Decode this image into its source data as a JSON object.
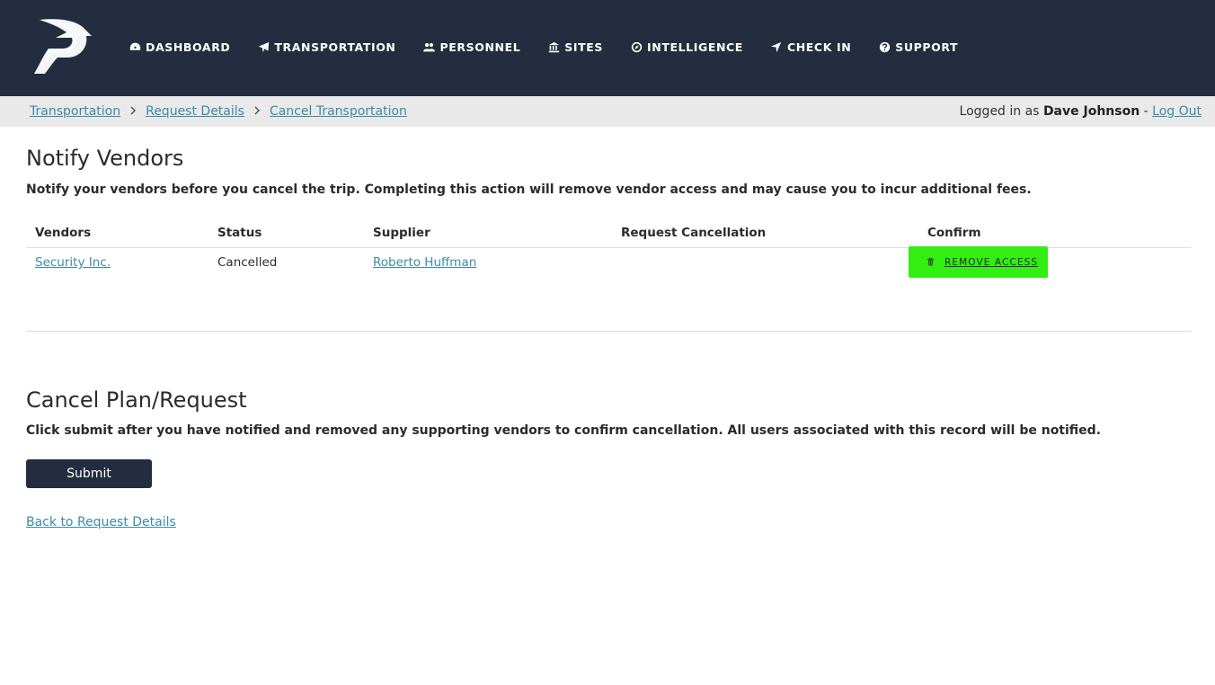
{
  "nav": {
    "items": [
      {
        "label": "DASHBOARD",
        "icon": "dashboard-icon"
      },
      {
        "label": "TRANSPORTATION",
        "icon": "plane-icon"
      },
      {
        "label": "PERSONNEL",
        "icon": "users-icon"
      },
      {
        "label": "SITES",
        "icon": "building-icon"
      },
      {
        "label": "INTELLIGENCE",
        "icon": "compass-icon"
      },
      {
        "label": "CHECK IN",
        "icon": "location-arrow-icon"
      },
      {
        "label": "SUPPORT",
        "icon": "question-icon"
      }
    ]
  },
  "breadcrumb": {
    "items": [
      "Transportation",
      "Request Details",
      "Cancel Transportation"
    ]
  },
  "user": {
    "prefix": "Logged in as",
    "name": "Dave Johnson",
    "separator": "-",
    "logout": "Log Out"
  },
  "notify": {
    "title": "Notify Vendors",
    "description": "Notify your vendors before you cancel the trip. Completing this action will remove vendor access and may cause you to incur additional fees.",
    "columns": [
      "Vendors",
      "Status",
      "Supplier",
      "Request Cancellation",
      "Confirm"
    ],
    "rows": [
      {
        "vendor": "Security Inc.",
        "status": "Cancelled",
        "supplier": "Roberto Huffman",
        "request_cancellation": "",
        "confirm_label": "REMOVE ACCESS"
      }
    ]
  },
  "cancel": {
    "title": "Cancel Plan/Request",
    "description": "Click submit after you have notified and removed any supporting vendors to confirm cancellation. All users associated with this record will be notified.",
    "submit_label": "Submit",
    "back_link": "Back to Request Details"
  },
  "colors": {
    "header_bg": "#232d3f",
    "link": "#3e8aa6",
    "highlight": "#33ee12"
  }
}
